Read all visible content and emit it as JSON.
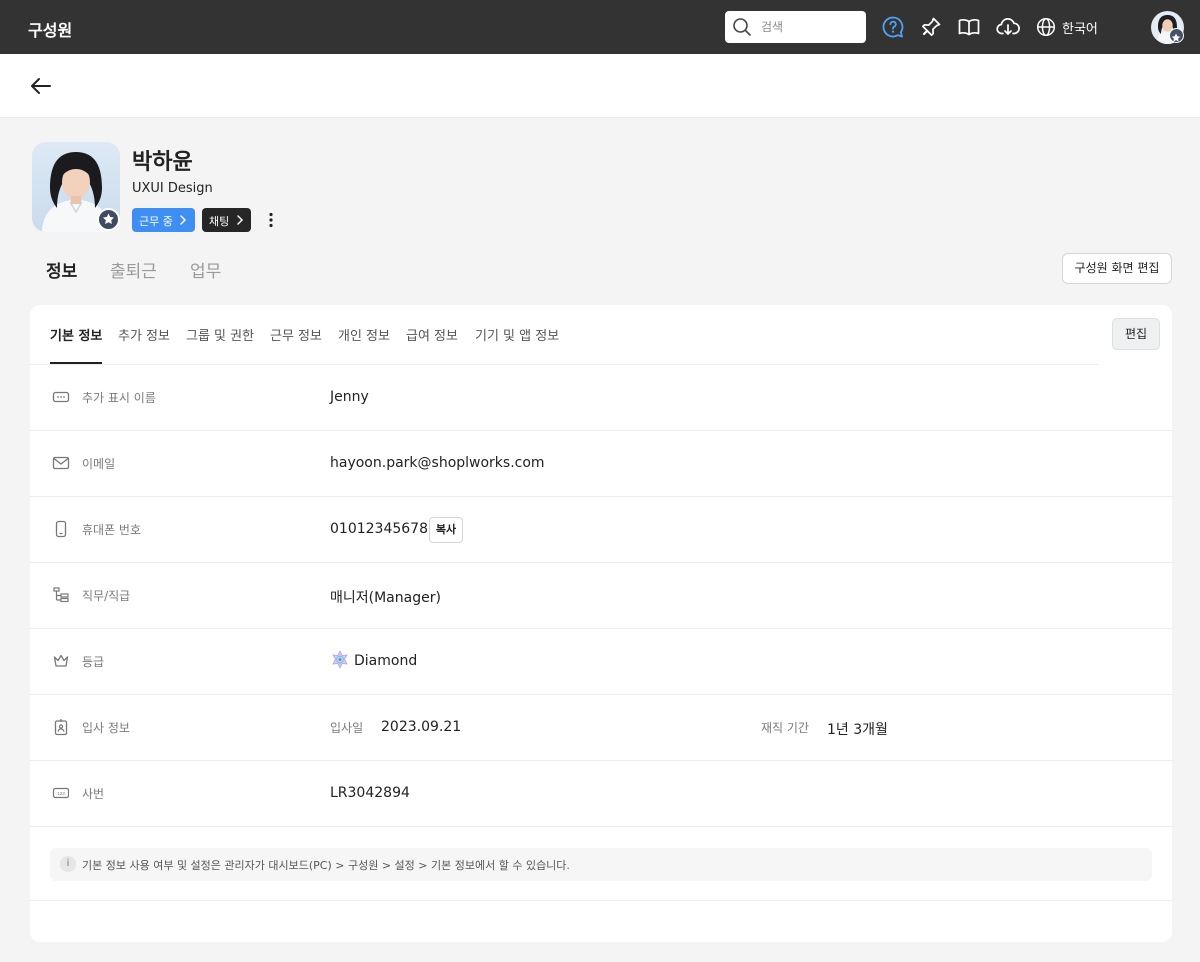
{
  "topbar": {
    "title": "구성원",
    "search_placeholder": "검색",
    "language": "한국어",
    "icons": [
      "search-icon",
      "help-icon",
      "pin-icon",
      "book-icon",
      "cloud-download-icon",
      "globe-icon"
    ]
  },
  "profile": {
    "name": "박하윤",
    "department": "UXUI Design",
    "status": "근무 중",
    "chat": "채팅"
  },
  "main_tabs": [
    "정보",
    "출퇴근",
    "업무"
  ],
  "edit_screen_label": "구성원 화면 편집",
  "sub_tabs": [
    "기본 정보",
    "추가 정보",
    "그룹 및 권한",
    "근무 정보",
    "개인 정보",
    "급여 정보",
    "기기 및 앱 정보"
  ],
  "edit_label": "편집",
  "rows": {
    "display_name": {
      "label": "추가 표시 이름",
      "value": "Jenny"
    },
    "email": {
      "label": "이메일",
      "value": "hayoon.park@shoplworks.com"
    },
    "phone": {
      "label": "휴대폰 번호",
      "value": "01012345678",
      "copy": "복사"
    },
    "position": {
      "label": "직무/직급",
      "value": "매니저(Manager)"
    },
    "grade": {
      "label": "등급",
      "value": "Diamond"
    },
    "join": {
      "label": "입사 정보",
      "join_date_label": "입사일",
      "join_date": "2023.09.21",
      "tenure_label": "재직 기간",
      "tenure": "1년 3개월"
    },
    "employee_no": {
      "label": "사번",
      "value": "LR3042894"
    }
  },
  "notice": "기본 정보 사용 여부 및 설정은 관리자가 대시보드(PC) > 구성원 >  설정 > 기본 정보에서 할 수 있습니다.",
  "colors": {
    "topbar": "#333333",
    "status_chip": "#3f8ef3",
    "chat_chip": "#262626",
    "help_icon": "#4da3f7"
  }
}
